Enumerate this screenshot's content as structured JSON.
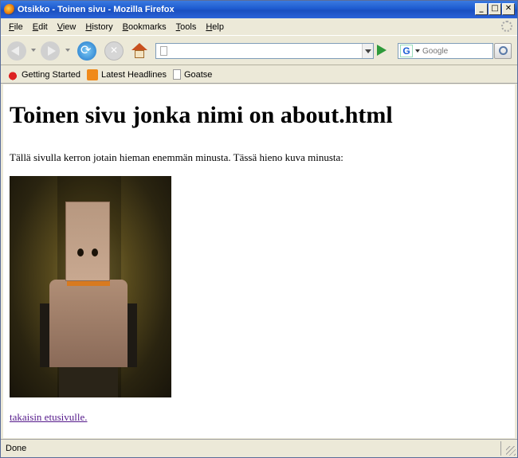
{
  "window": {
    "title": "Otsikko - Toinen sivu - Mozilla Firefox",
    "controls": {
      "minimize": "_",
      "maximize": "□",
      "close": "✕"
    }
  },
  "menubar": {
    "items": [
      {
        "label": "File",
        "access": "F",
        "rest": "ile"
      },
      {
        "label": "Edit",
        "access": "E",
        "rest": "dit"
      },
      {
        "label": "View",
        "access": "V",
        "rest": "iew"
      },
      {
        "label": "History",
        "access": "H",
        "rest": "istory"
      },
      {
        "label": "Bookmarks",
        "access": "B",
        "rest": "ookmarks"
      },
      {
        "label": "Tools",
        "access": "T",
        "rest": "ools"
      },
      {
        "label": "Help",
        "access": "H",
        "rest": "elp"
      }
    ]
  },
  "navbar": {
    "url_value": "",
    "search_placeholder": "Google",
    "search_engine_icon": "G"
  },
  "bookmarks": {
    "items": [
      {
        "label": "Getting Started",
        "icon": "firefox-icon"
      },
      {
        "label": "Latest Headlines",
        "icon": "rss-icon"
      },
      {
        "label": "Goatse",
        "icon": "page-icon"
      }
    ]
  },
  "content": {
    "heading": "Toinen sivu jonka nimi on about.html",
    "intro": "Tällä sivulla kerron jotain hieman enemmän minusta. Tässä hieno kuva minusta:",
    "back_link": "takaisin etusivulle."
  },
  "statusbar": {
    "text": "Done"
  }
}
